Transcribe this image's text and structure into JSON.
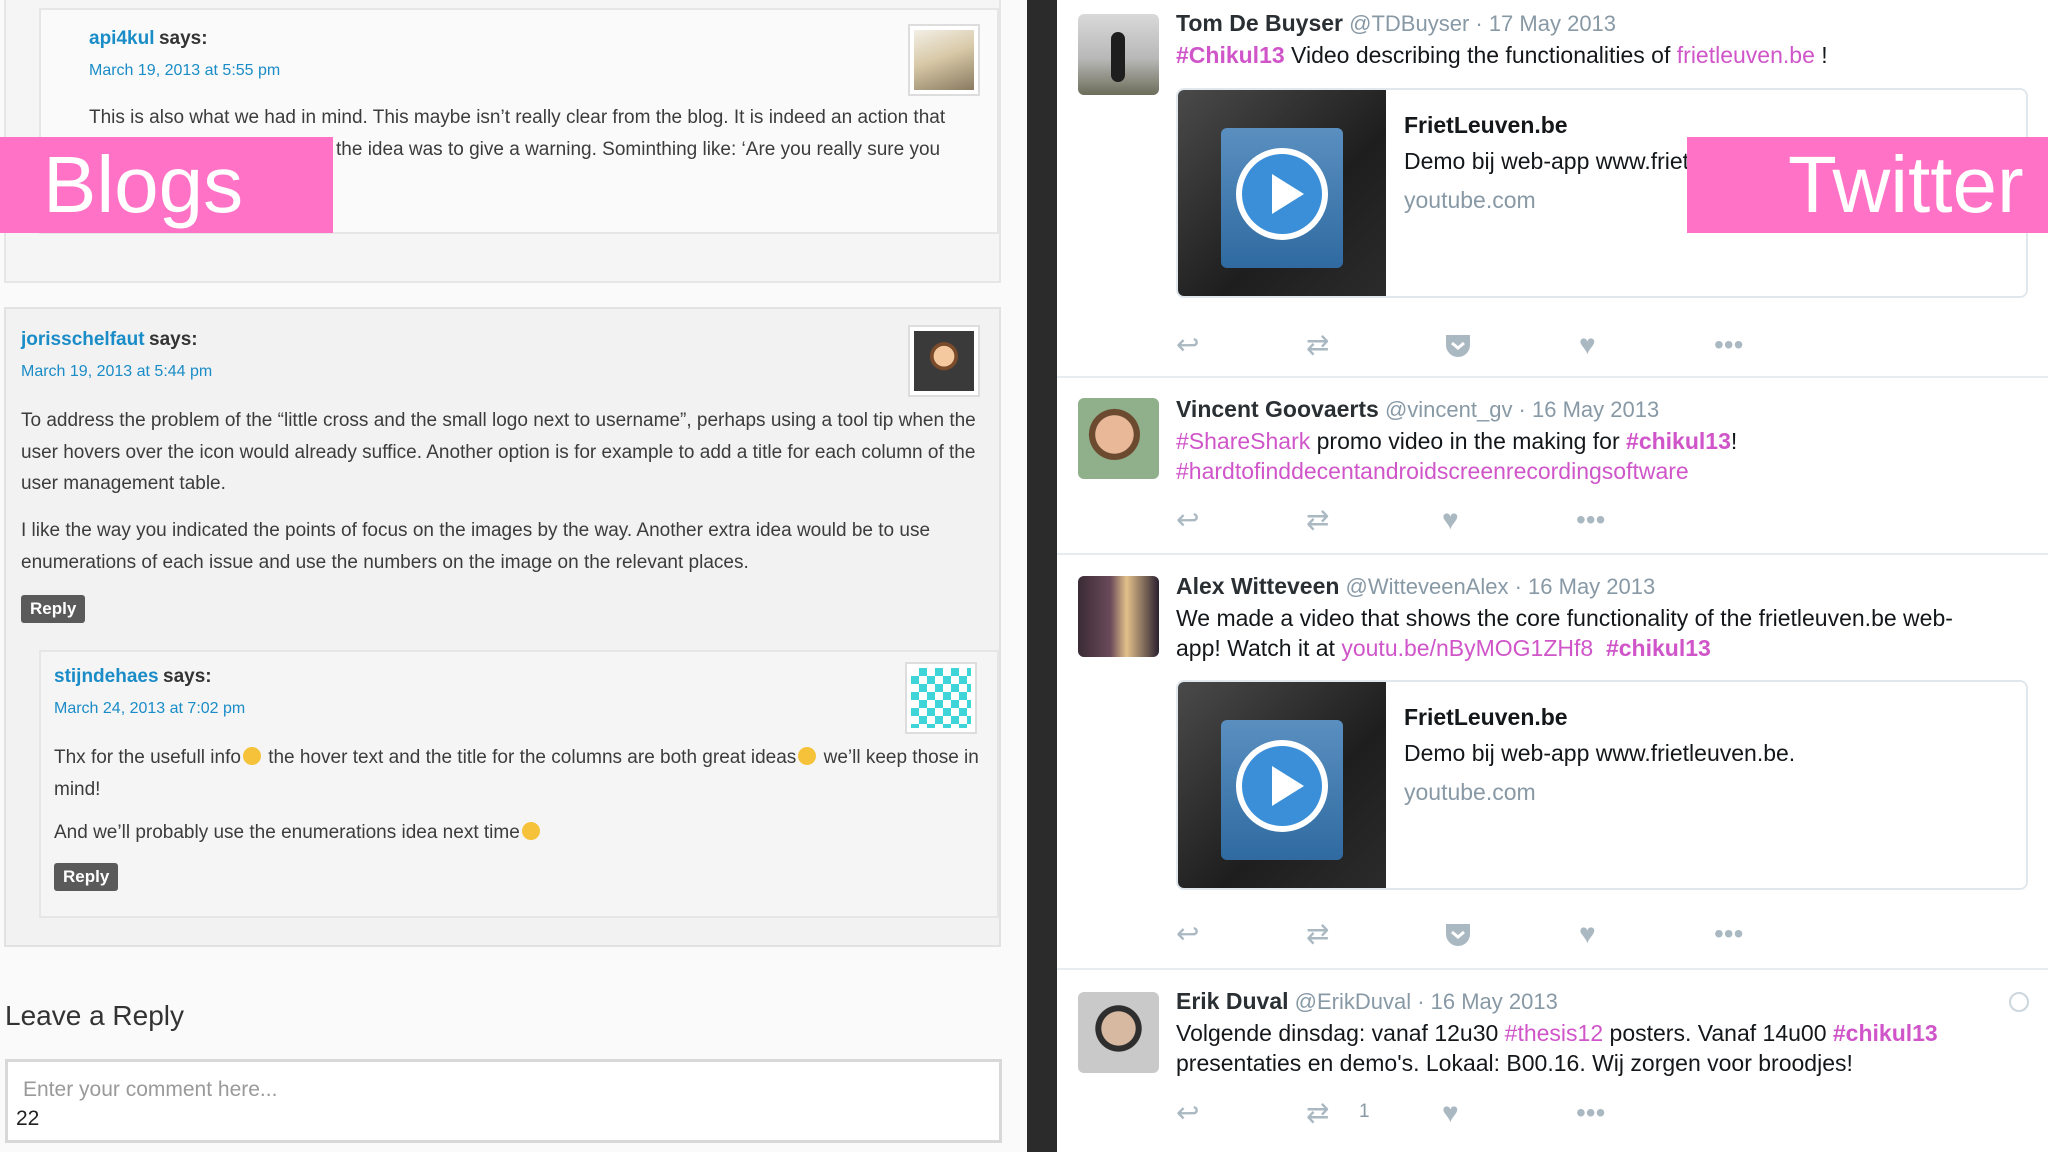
{
  "blog": {
    "c1": {
      "author": "api4kul",
      "says": "says:",
      "date": "March 19, 2013 at 5:55 pm",
      "line1": "This is also what we had in mind. This maybe isn’t really clear from the blog. It is indeed an action that",
      "line2": "the idea was to give a warning. Sominthing like: ‘Are you really sure you"
    },
    "c2": {
      "author": "jorisschelfaut",
      "says": "says:",
      "date": "March 19, 2013 at 5:44 pm",
      "p1": "To address the problem of the “little cross and the small logo next to username”, perhaps using a tool tip when the user hovers over the icon would already suffice. Another option is for example to add a title for each column of the user management table.",
      "p2": "I like the way you indicated the points of focus on the images by the way. Another extra idea would be to use enumerations of each issue and use the numbers on the image on the relevant places.",
      "reply": "Reply"
    },
    "c3": {
      "author": "stijndehaes",
      "says": "says:",
      "date": "March 24, 2013 at 7:02 pm",
      "p1a": "Thx for the usefull info",
      "p1b": " the hover text and the title for the columns are both great ideas",
      "p1c": " we’ll keep those in mind!",
      "p2": "And we’ll probably use the enumerations idea next time",
      "reply": "Reply"
    },
    "leave_reply": "Leave a Reply",
    "comment_placeholder": "Enter your comment here...",
    "slide_number": "22"
  },
  "labels": {
    "blogs": "Blogs",
    "twitter": "Twitter"
  },
  "tweets": [
    {
      "name": "Tom De Buyser",
      "meta": "@TDBuyser · 17 May 2013",
      "tag1": "#Chikul13",
      "text1": " Video describing the functionalities of ",
      "link": "frietleuven.be",
      "text2": " !",
      "card": {
        "title": "FrietLeuven.be",
        "desc": "Demo bij web-app www.frietleuven.be.",
        "url": "youtube.com"
      }
    },
    {
      "name": "Vincent Goovaerts",
      "meta": "@vincent_gv · 16 May 2013",
      "tag1": "#ShareShark",
      "text1": " promo video in the making for ",
      "tag2": "#chikul13",
      "text2": "!",
      "tag3": "#hardtofinddecentandroidscreenrecordingsoftware"
    },
    {
      "name": "Alex Witteveen",
      "meta": "@WitteveenAlex · 16 May 2013",
      "text1": "We made a video that shows the core functionality of the frietleuven.be web-app! Watch it at ",
      "link": "youtu.be/nByMOG1ZHf8",
      "tag2": "#chikul13",
      "card": {
        "title": "FrietLeuven.be",
        "desc": "Demo bij web-app www.frietleuven.be.",
        "url": "youtube.com"
      }
    },
    {
      "name": "Erik Duval",
      "meta": "@ErikDuval · 16 May 2013",
      "text1": "Volgende dinsdag: vanaf 12u30 ",
      "tag1": "#thesis12",
      "text2": " posters. Vanaf 14u00 ",
      "tag2": "#chikul13",
      "text3": "presentaties en demo's. Lokaal: B00.16. Wij zorgen voor broodjes!",
      "retweet_count": "1"
    }
  ]
}
